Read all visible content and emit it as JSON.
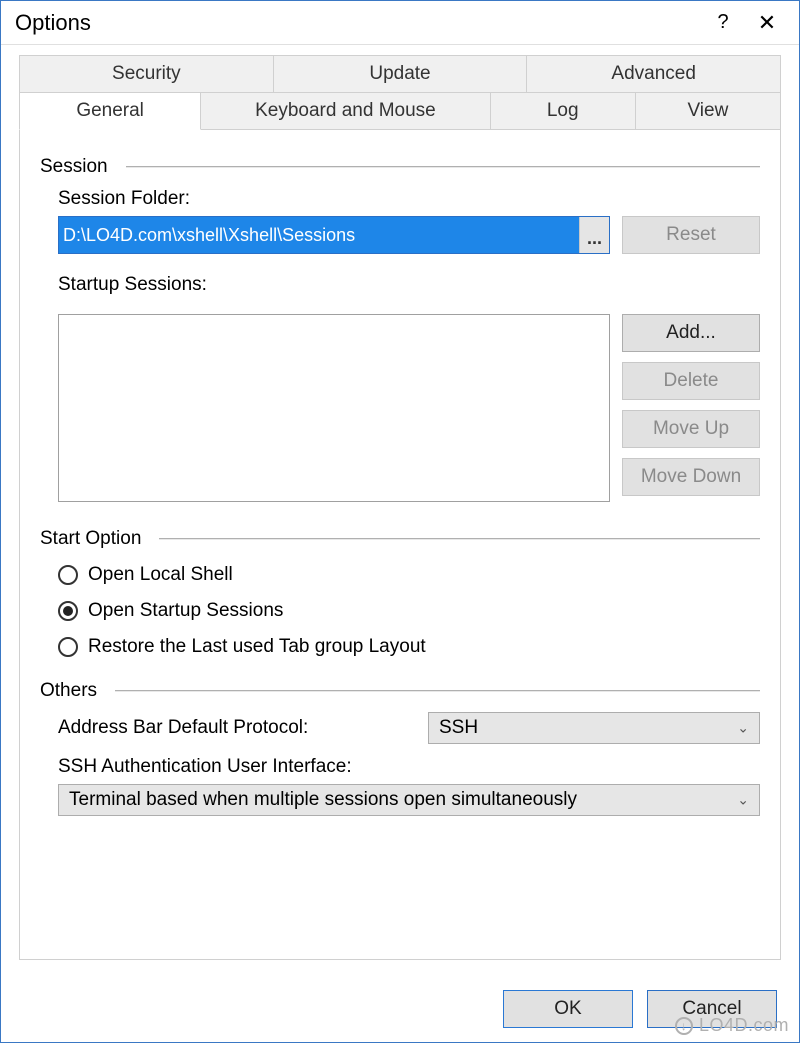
{
  "window": {
    "title": "Options"
  },
  "tabs_row1": [
    "Security",
    "Update",
    "Advanced"
  ],
  "tabs_row2": [
    "General",
    "Keyboard and Mouse",
    "Log",
    "View"
  ],
  "active_tab": "General",
  "session": {
    "heading": "Session",
    "folder_label": "Session Folder:",
    "folder_value": "D:\\LO4D.com\\xshell\\Xshell\\Sessions",
    "browse": "...",
    "reset": "Reset",
    "startup_label": "Startup Sessions:",
    "buttons": {
      "add": "Add...",
      "delete": "Delete",
      "move_up": "Move Up",
      "move_down": "Move Down"
    }
  },
  "start_option": {
    "heading": "Start Option",
    "options": [
      "Open Local Shell",
      "Open Startup Sessions",
      "Restore the Last used Tab group Layout"
    ],
    "selected_index": 1
  },
  "others": {
    "heading": "Others",
    "protocol_label": "Address Bar Default Protocol:",
    "protocol_value": "SSH",
    "auth_label": "SSH Authentication User Interface:",
    "auth_value": "Terminal based when multiple sessions open simultaneously"
  },
  "footer": {
    "ok": "OK",
    "cancel": "Cancel"
  },
  "watermark": "LO4D.com"
}
